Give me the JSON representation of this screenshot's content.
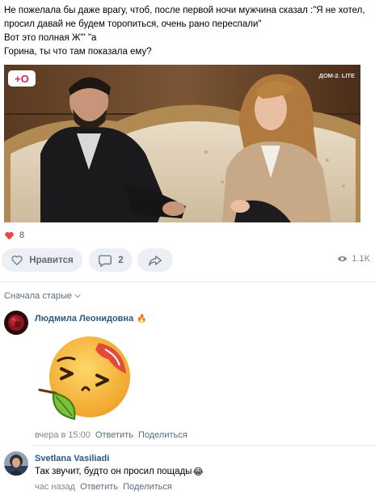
{
  "post": {
    "lines": [
      "Не пожелала бы даже врагу, чтоб, после первой ночи мужчина сказал :\"Я не хотел,",
      "просил давай не будем торопиться, очень рано переспали\"",
      "Вот это полная Ж\"' \"а",
      "Горина, ты что там показала ему?"
    ]
  },
  "video": {
    "channel_logo": "+О",
    "watermark": "ДОМ-2. LITE"
  },
  "reactions": {
    "likes_count": "8",
    "like_label": "Нравится",
    "comments_count": "2",
    "views_count": "1.1K",
    "icons": [
      "heart-icon",
      "comment-icon",
      "share-icon",
      "eye-icon"
    ]
  },
  "comments_section": {
    "sort_label": "Сначала старые"
  },
  "comments": [
    {
      "author": "Людмила Леонидовна",
      "badge": "🔥",
      "sticker": "smiling-emoji-sticker",
      "time": "вчера в 15:00",
      "reply": "Ответить",
      "share": "Поделиться"
    },
    {
      "author": "Svetlana Vasiliadi",
      "text": "Так звучит, будто он просил пощады",
      "emoji": "😂",
      "time": "час назад",
      "reply": "Ответить",
      "share": "Поделиться"
    }
  ],
  "colors": {
    "link": "#2a5885",
    "like_heart": "#e64646",
    "button_bg": "#eceff3",
    "muted": "#7b8793"
  }
}
